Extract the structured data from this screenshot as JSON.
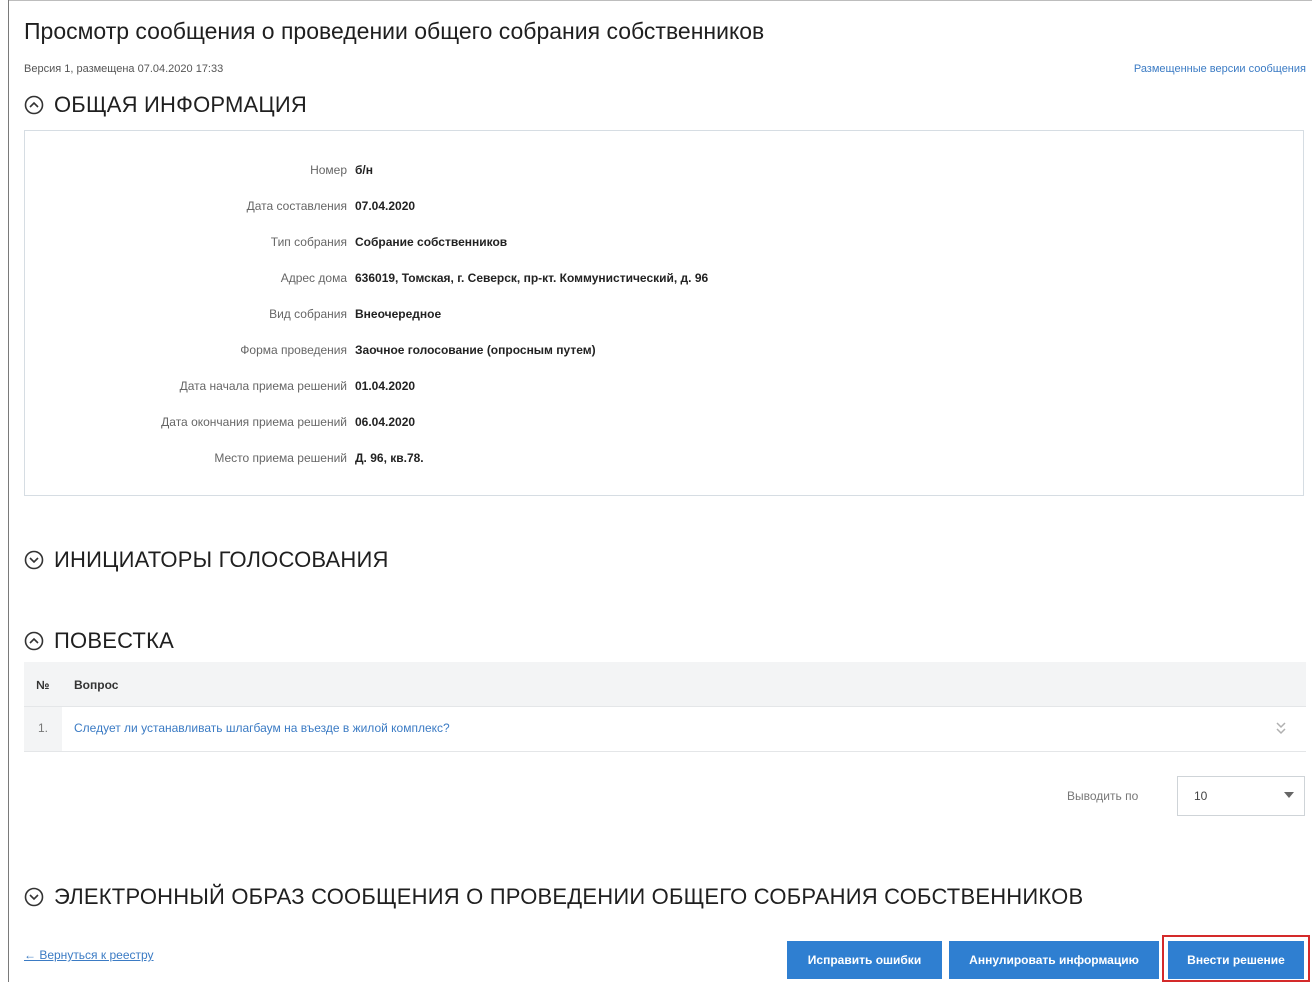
{
  "page": {
    "title": "Просмотр сообщения о проведении общего собрания собственников",
    "version_info": "Версия 1, размещена 07.04.2020 17:33",
    "versions_link": "Размещенные версии сообщения"
  },
  "sections": {
    "general": "ОБЩАЯ ИНФОРМАЦИЯ",
    "initiators": "ИНИЦИАТОРЫ ГОЛОСОВАНИЯ",
    "agenda": "ПОВЕСТКА",
    "electronic_image": "ЭЛЕКТРОННЫЙ ОБРАЗ СООБЩЕНИЯ О ПРОВЕДЕНИИ ОБЩЕГО СОБРАНИЯ СОБСТВЕННИКОВ"
  },
  "general_info": [
    {
      "label": "Номер",
      "value": "б/н"
    },
    {
      "label": "Дата составления",
      "value": "07.04.2020"
    },
    {
      "label": "Тип собрания",
      "value": "Собрание собственников"
    },
    {
      "label": "Адрес дома",
      "value": "636019, Томская, г. Северск, пр-кт. Коммунистический, д. 96"
    },
    {
      "label": "Вид собрания",
      "value": "Внеочередное"
    },
    {
      "label": "Форма проведения",
      "value": "Заочное голосование (опросным путем)"
    },
    {
      "label": "Дата начала приема решений",
      "value": "01.04.2020"
    },
    {
      "label": "Дата окончания приема решений",
      "value": "06.04.2020"
    },
    {
      "label": "Место приема решений",
      "value": "Д. 96, кв.78."
    }
  ],
  "agenda_table": {
    "headers": [
      "№",
      "Вопрос"
    ],
    "rows": [
      {
        "num": "1.",
        "question": "Следует ли устанавливать шлагбаум на въезде в жилой комплекс?"
      }
    ]
  },
  "pager": {
    "label": "Выводить по",
    "selected": "10"
  },
  "footer": {
    "back_link": "← Вернуться к реестру",
    "btn_fix": "Исправить ошибки",
    "btn_annul": "Аннулировать информацию",
    "btn_decide": "Внести решение"
  },
  "icons": {
    "section_expanded": "chevron-up-circle-icon",
    "section_collapsed": "chevron-down-circle-icon",
    "row_expand": "double-chevron-down-icon"
  },
  "colors": {
    "link": "#3b7bc4",
    "button": "#2f7fd1",
    "highlight": "#d42a2a"
  }
}
